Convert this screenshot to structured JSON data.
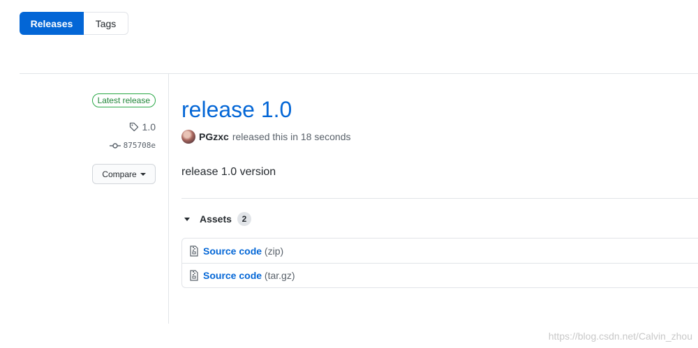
{
  "tabs": {
    "releases": "Releases",
    "tags": "Tags"
  },
  "meta": {
    "latest_badge": "Latest release",
    "tag": "1.0",
    "commit": "875708e",
    "compare_label": "Compare"
  },
  "release": {
    "title": "release 1.0",
    "author": "PGzxc",
    "released_text": "released this in 18 seconds",
    "body": "release 1.0 version"
  },
  "assets": {
    "label": "Assets",
    "count": "2",
    "items": [
      {
        "name": "Source code",
        "ext": "(zip)"
      },
      {
        "name": "Source code",
        "ext": "(tar.gz)"
      }
    ]
  },
  "watermark": "https://blog.csdn.net/Calvin_zhou",
  "colors": {
    "accent": "#0366d6",
    "latest_green": "#28a745"
  },
  "icons": [
    "tag-icon",
    "git-commit-icon",
    "file-zip-icon",
    "caret-down-icon"
  ]
}
